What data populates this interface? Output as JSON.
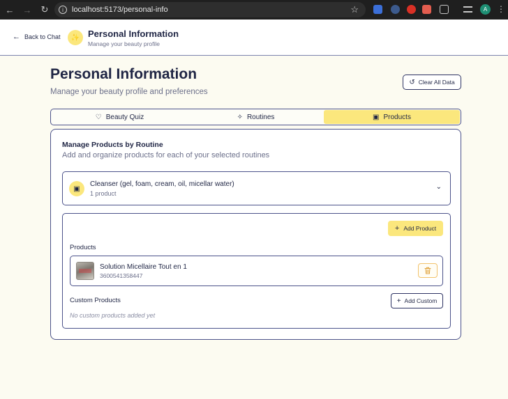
{
  "browser": {
    "back_icon": "arrow-left-icon",
    "forward_icon": "arrow-right-icon",
    "reload_icon": "reload-icon",
    "url": "localhost:5173/personal-info",
    "avatar_letter": "A"
  },
  "header": {
    "back_label": "Back to Chat",
    "title": "Personal Information",
    "subtitle": "Manage your beauty profile"
  },
  "page": {
    "title": "Personal Information",
    "subtitle": "Manage your beauty profile and preferences",
    "clear_label": "Clear All Data"
  },
  "tabs": [
    {
      "label": "Beauty Quiz",
      "icon": "heart-icon",
      "active": false
    },
    {
      "label": "Routines",
      "icon": "sparkles-icon",
      "active": false
    },
    {
      "label": "Products",
      "icon": "box-icon",
      "active": true
    }
  ],
  "card": {
    "title": "Manage Products by Routine",
    "subtitle": "Add and organize products for each of your selected routines"
  },
  "routine": {
    "name": "Cleanser (gel, foam, cream, oil, micellar water)",
    "count": "1 product"
  },
  "panel": {
    "add_product_label": "Add Product",
    "products_label": "Products",
    "custom_label": "Custom Products",
    "add_custom_label": "Add Custom",
    "empty_text": "No custom products added yet"
  },
  "products": [
    {
      "name": "Solution Micellaire Tout en 1",
      "code": "3600541358447"
    }
  ],
  "colors": {
    "accent": "#fbe77d",
    "border": "#4b528a",
    "text": "#1f2544",
    "muted": "#6b6f8a",
    "background": "#fcfbf1"
  }
}
